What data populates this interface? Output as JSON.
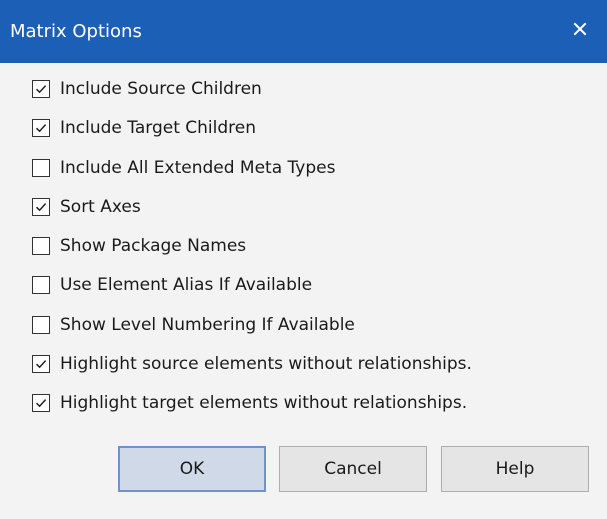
{
  "window": {
    "title": "Matrix Options",
    "close_icon": "close-icon",
    "title_bar_color": "#1c5fb6"
  },
  "options": [
    {
      "label": "Include Source Children",
      "checked": true
    },
    {
      "label": "Include Target Children",
      "checked": true
    },
    {
      "label": "Include All Extended Meta Types",
      "checked": false
    },
    {
      "label": "Sort Axes",
      "checked": true
    },
    {
      "label": "Show Package Names",
      "checked": false
    },
    {
      "label": "Use Element Alias If Available",
      "checked": false
    },
    {
      "label": "Show Level Numbering If Available",
      "checked": false
    },
    {
      "label": "Highlight source elements without relationships.",
      "checked": true
    },
    {
      "label": "Highlight target elements without relationships.",
      "checked": true
    }
  ],
  "buttons": {
    "ok_label": "OK",
    "cancel_label": "Cancel",
    "help_label": "Help"
  }
}
